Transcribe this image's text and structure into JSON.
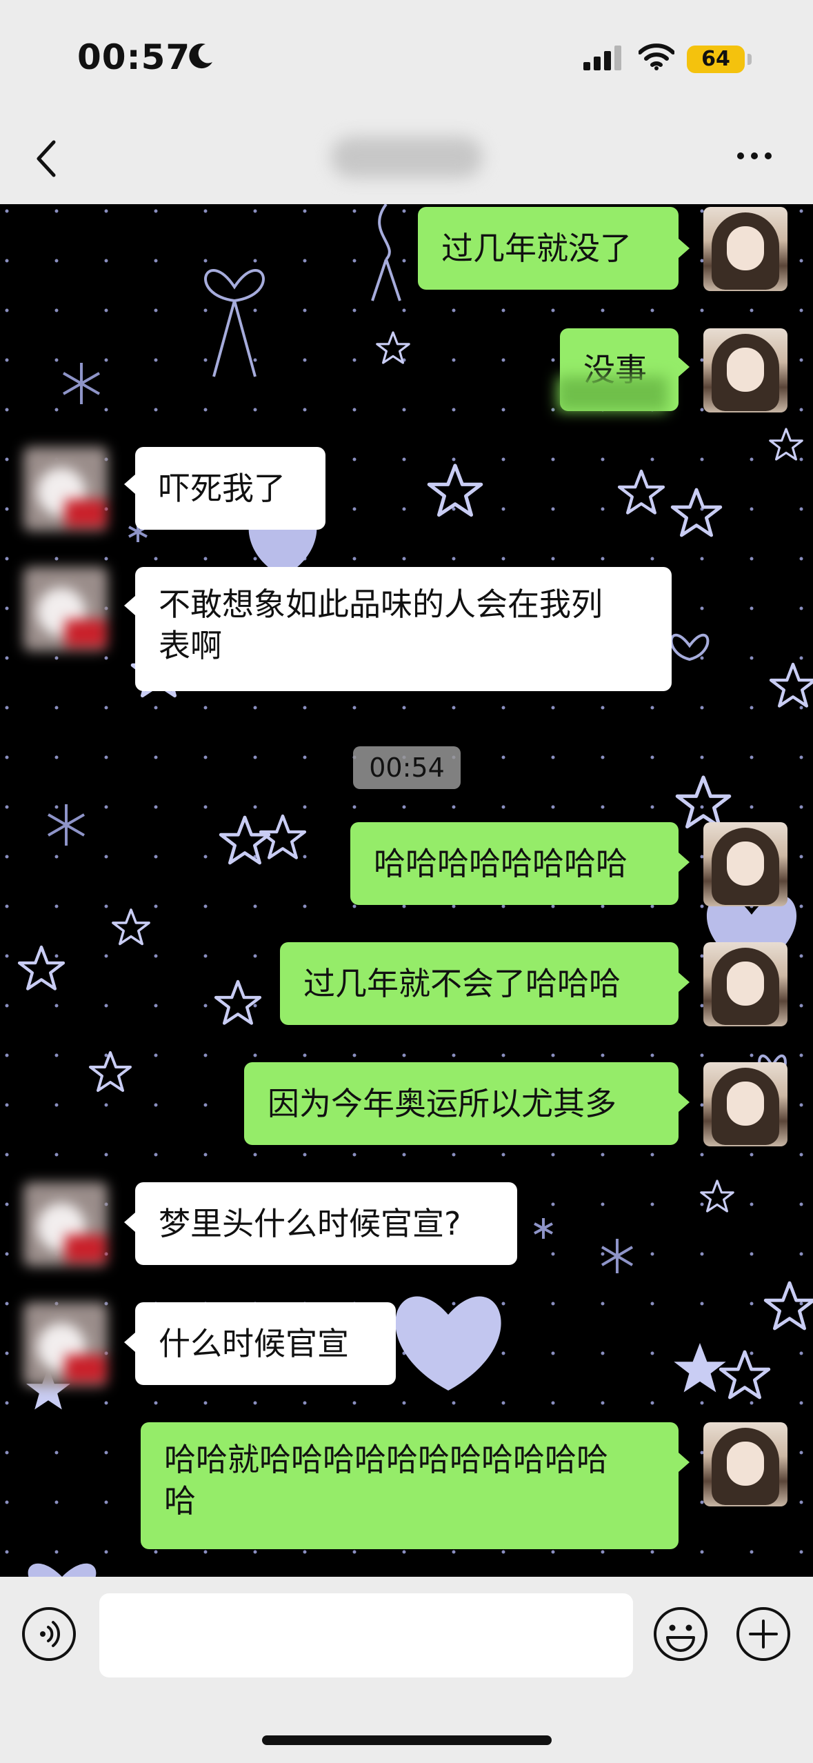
{
  "status_bar": {
    "time": "00:57",
    "battery_level": "64",
    "moon_icon": "moon-icon",
    "signal_icon": "signal-icon",
    "wifi_icon": "wifi-icon"
  },
  "nav": {
    "back_icon": "chevron-left-icon",
    "more_icon": "more-icon"
  },
  "colors": {
    "me_bubble": "#95ec69",
    "them_bubble": "#ffffff",
    "chat_bg": "#000000",
    "bar_bg": "#ececec",
    "battery": "#f4c20d"
  },
  "messages": [
    {
      "from": "me",
      "text": "过几年就没了"
    },
    {
      "from": "me",
      "text": "没事"
    },
    {
      "from": "them",
      "text": "吓死我了"
    },
    {
      "from": "them",
      "text": "不敢想象如此品味的人会在我列\n表啊"
    },
    {
      "from": "me",
      "text": "哈哈哈哈哈哈哈哈"
    },
    {
      "from": "me",
      "text": "过几年就不会了哈哈哈"
    },
    {
      "from": "me",
      "text": "因为今年奥运所以尤其多"
    },
    {
      "from": "them",
      "text": "梦里头什么时候官宣?"
    },
    {
      "from": "them",
      "text": "什么时候官宣"
    },
    {
      "from": "me",
      "text": "哈哈就哈哈哈哈哈哈哈哈哈哈哈\n哈"
    }
  ],
  "timestamp": "00:54",
  "input_bar": {
    "voice_icon": "voice-icon",
    "emoji_icon": "emoji-icon",
    "plus_icon": "plus-icon",
    "input_value": ""
  }
}
